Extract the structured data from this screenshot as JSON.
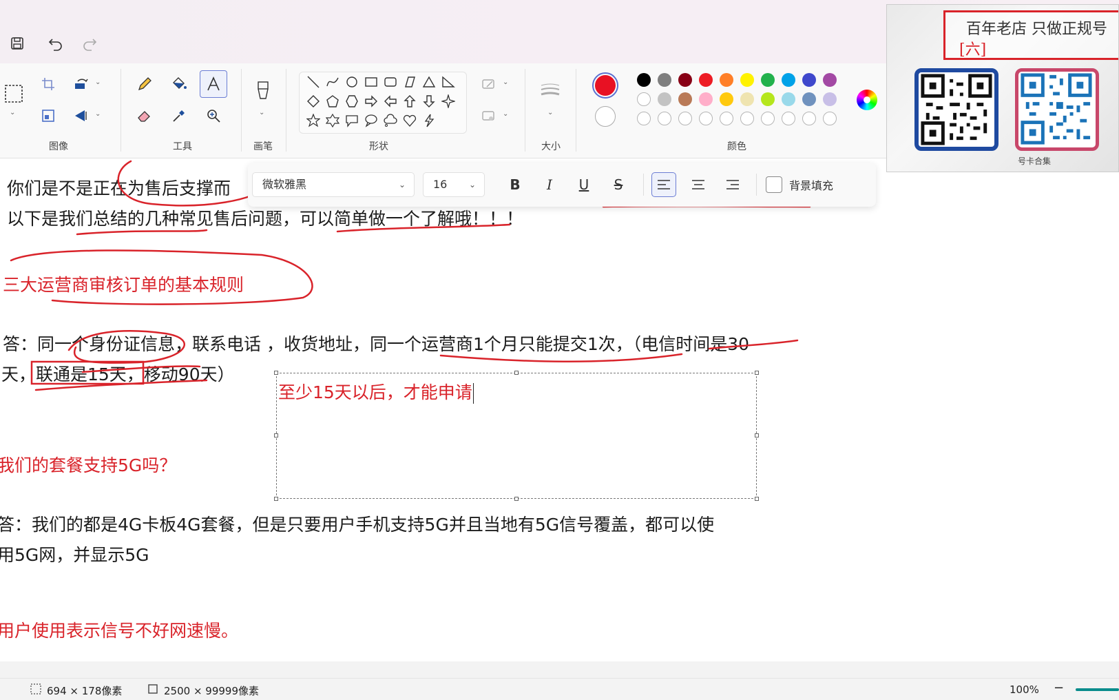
{
  "toolbar": {
    "groups": {
      "image": "图像",
      "tools": "工具",
      "brushes": "画笔",
      "shapes": "形状",
      "size": "大小",
      "colors": "颜色"
    },
    "selected_tool": "text"
  },
  "text_toolbar": {
    "font": "微软雅黑",
    "font_size": "16",
    "bold": "B",
    "italic": "I",
    "underline": "U",
    "strikethrough": "S",
    "alignment": "left",
    "background_fill_label": "背景填充"
  },
  "palette": {
    "primary": "#e81123",
    "secondary": "#ffffff",
    "row1": [
      "#000000",
      "#7f7f7f",
      "#880015",
      "#ed1c24",
      "#ff7f27",
      "#fff200",
      "#22b14c",
      "#00a2e8",
      "#3f48cc",
      "#a349a4"
    ],
    "row2": [
      "#ffffff",
      "#c3c3c3",
      "#b97a57",
      "#ffaec9",
      "#ffc90e",
      "#efe4b0",
      "#b5e61d",
      "#99d9ea",
      "#7092be",
      "#c8bfe7"
    ],
    "row3_empty": 10
  },
  "canvas": {
    "lines": [
      {
        "text": "你们是不是正在为售后支撑而",
        "color": "black"
      },
      {
        "text": "以下是我们总结的几种常见售后问题，可以简单做一个了解哦！！！",
        "color": "black"
      },
      {
        "text": "三大运营商审核订单的基本规则",
        "color": "red"
      },
      {
        "text": "答：同一个身份证信息，联系电话 ，收货地址，同一个运营商1个月只能提交1次，（电信时间是30",
        "color": "black"
      },
      {
        "text": "天，联通是15天，移动90天）",
        "color": "black"
      },
      {
        "text": "我们的套餐支持5G吗？",
        "color": "red"
      },
      {
        "text": "答：我们的都是4G卡板4G套餐，但是只要用户手机支持5G并且当地有5G信号覆盖，都可以使",
        "color": "black"
      },
      {
        "text": "用5G网，并显示5G",
        "color": "black"
      },
      {
        "text": "用户使用表示信号不好网速慢。",
        "color": "red"
      }
    ],
    "textbox_text": "至少15天以后，才能申请"
  },
  "ad": {
    "headline": "百年老店 只做正规号",
    "badge": "[六]",
    "caption_right": "号卡合集"
  },
  "status": {
    "selection_size": "694 × 178像素",
    "canvas_size": "2500 × 99999像素",
    "zoom": "100%"
  }
}
